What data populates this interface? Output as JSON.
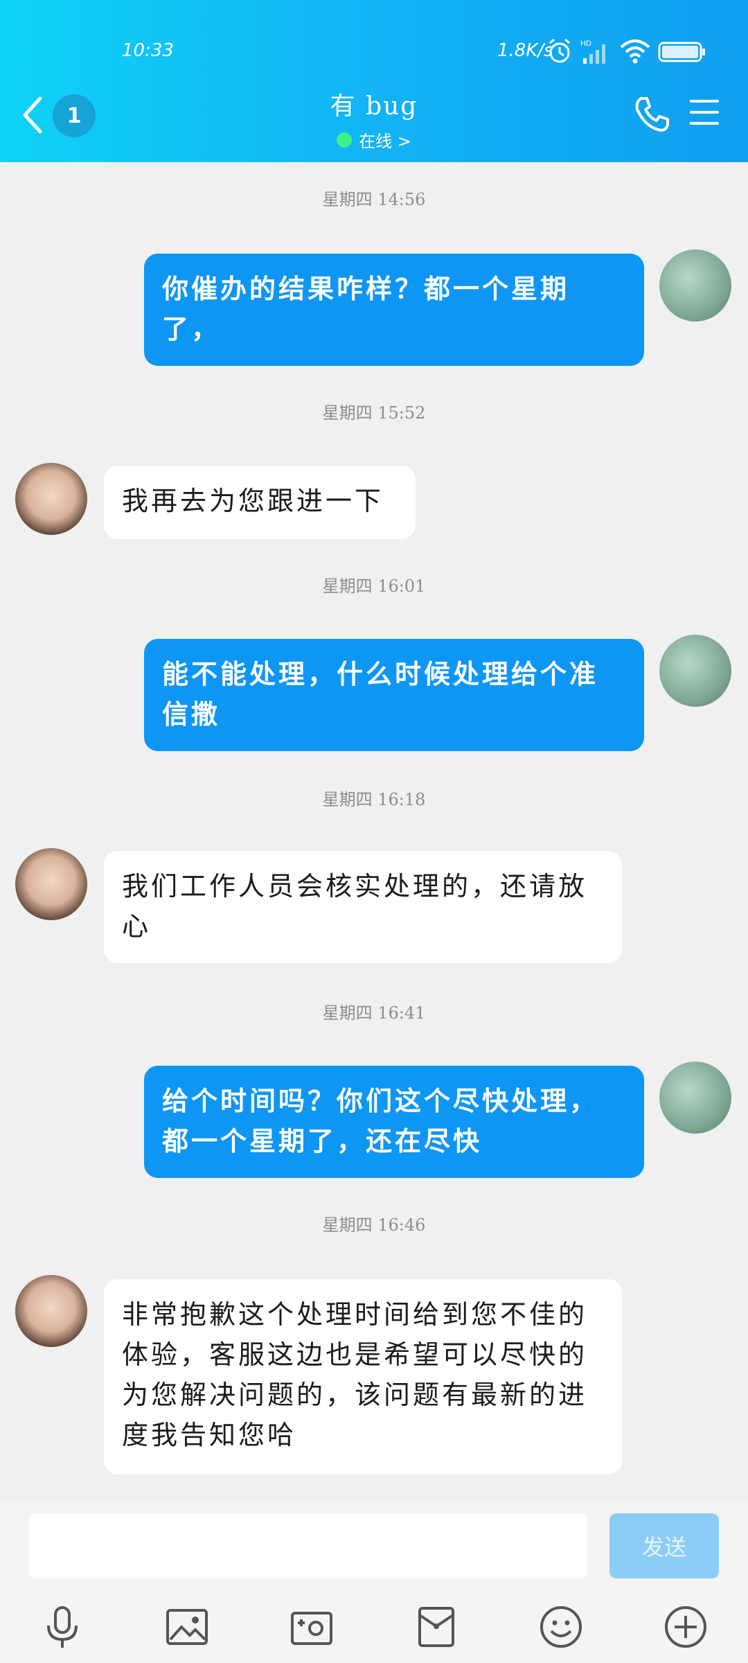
{
  "status_bar": {
    "time": "10:33",
    "net_speed": "1.8K/s",
    "battery": "99"
  },
  "header": {
    "unread_count": "1",
    "contact_name": "有 bug",
    "presence": "在线 >"
  },
  "messages": [
    {
      "timestamp": "星期四 14:56",
      "from": "me",
      "text": "你催办的结果咋样？都一个星期了，"
    },
    {
      "timestamp": "星期四 15:52",
      "from": "agent",
      "text": "我再去为您跟进一下"
    },
    {
      "timestamp": "星期四 16:01",
      "from": "me",
      "text": "能不能处理，什么时候处理给个准信撒"
    },
    {
      "timestamp": "星期四 16:18",
      "from": "agent",
      "text": "我们工作人员会核实处理的，还请放心"
    },
    {
      "timestamp": "星期四 16:41",
      "from": "me",
      "text": "给个时间吗？你们这个尽快处理，都一个星期了，还在尽快"
    },
    {
      "timestamp": "星期四 16:46",
      "from": "agent",
      "text": "非常抱歉这个处理时间给到您不佳的体验，客服这边也是希望可以尽快的为您解决问题的，该问题有最新的进度我告知您哈"
    }
  ],
  "input": {
    "placeholder": "",
    "send_label": "发送"
  },
  "toolbar": {
    "icons": [
      "microphone-icon",
      "image-icon",
      "camera-icon",
      "red-packet-icon",
      "emoji-icon",
      "plus-icon"
    ]
  },
  "colors": {
    "header_start": "#0fd2f6",
    "header_end": "#0f9ef0",
    "outgoing_bubble": "#0e96f4",
    "send_button": "#8ccdf8"
  }
}
